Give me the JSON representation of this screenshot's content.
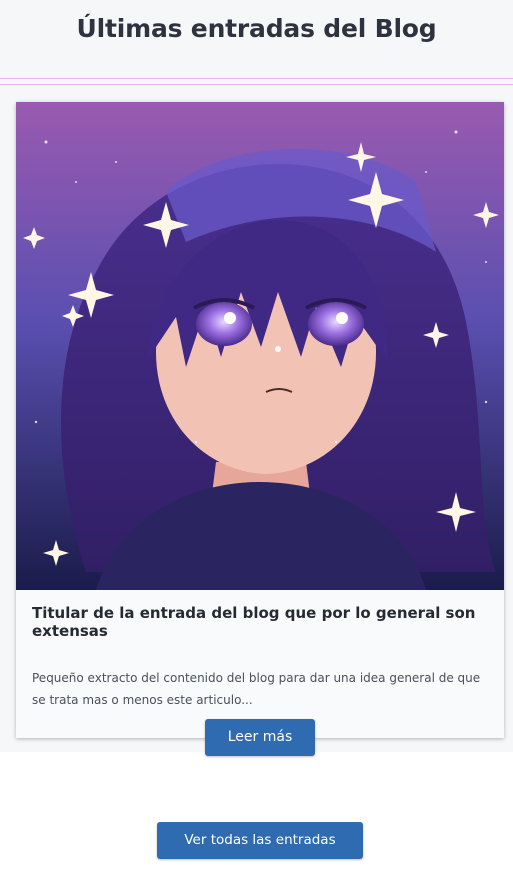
{
  "section": {
    "title": "Últimas entradas del Blog"
  },
  "post": {
    "image_subject": "anime-girl-purple-hair-portrait",
    "title": "Titular de la entrada del blog que por lo general son extensas",
    "excerpt": "Pequeño extracto del contenido del blog para dar una idea general de que se trata mas o menos este articulo...",
    "read_more_label": "Leer más"
  },
  "footer": {
    "view_all_label": "Ver todas las entradas"
  },
  "colors": {
    "button": "#2e6bb0",
    "divider": "#e3b8ec",
    "section_bg": "#f6f7f9"
  }
}
